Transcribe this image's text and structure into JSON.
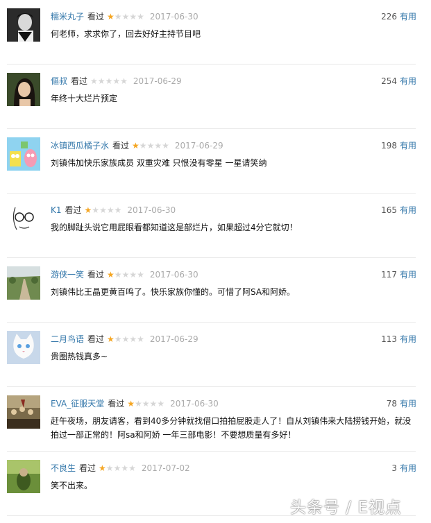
{
  "reviews": [
    {
      "user": "糯米丸子",
      "watched": "看过",
      "rating": 1,
      "date": "2017-06-30",
      "useful_count": "226",
      "useful_label": "有用",
      "comment": "何老师，求求你了，回去好好主持节目吧",
      "avatar": "portrait-man-bw"
    },
    {
      "user": "傴叔",
      "watched": "看过",
      "rating": 0,
      "date": "2017-06-29",
      "useful_count": "254",
      "useful_label": "有用",
      "comment": "年终十大烂片预定",
      "avatar": "portrait-woman"
    },
    {
      "user": "冰镇西瓜橘子水",
      "watched": "看过",
      "rating": 1,
      "date": "2017-06-29",
      "useful_count": "198",
      "useful_label": "有用",
      "comment": "刘镇伟加快乐家族成员 双重灾难 只恨没有零星 一星请笑纳",
      "avatar": "cartoon-sponge"
    },
    {
      "user": "K1",
      "watched": "看过",
      "rating": 1,
      "date": "2017-06-30",
      "useful_count": "165",
      "useful_label": "有用",
      "comment": "我的脚趾头说它用屁眼看都知道这是部烂片，如果超过4分它就切！",
      "avatar": "sketch-face-glasses"
    },
    {
      "user": "游侠一笑",
      "watched": "看过",
      "rating": 1,
      "date": "2017-06-30",
      "useful_count": "117",
      "useful_label": "有用",
      "comment": "刘镇伟比王晶更黄百鸣了。快乐家族你懂的。可惜了阿SA和阿娇。",
      "avatar": "landscape-path"
    },
    {
      "user": "二月鸟语",
      "watched": "看过",
      "rating": 1,
      "date": "2017-06-29",
      "useful_count": "113",
      "useful_label": "有用",
      "comment": "贵圈热钱真多~",
      "avatar": "white-cat"
    },
    {
      "user": "EVA_征服天堂",
      "watched": "看过",
      "rating": 1,
      "date": "2017-06-30",
      "useful_count": "78",
      "useful_label": "有用",
      "comment": "赶午夜场，朋友请客，看到40多分钟就找借口拍拍屁股走人了！自从刘镇伟来大陆捞钱开始，就没拍过一部正常的！阿sa和阿娇 一年三部电影！不要想质量有多好！",
      "avatar": "painting-crowd"
    },
    {
      "user": "不良生",
      "watched": "看过",
      "rating": 1,
      "date": "2017-07-02",
      "useful_count": "3",
      "useful_label": "有用",
      "comment": "笑不出来。",
      "avatar": "green-figure"
    }
  ],
  "stars_total": 5,
  "colors": {
    "link": "#3377aa",
    "star_on": "#f5a623",
    "star_off": "#d6d6d6",
    "date": "#aaaaaa"
  },
  "watermark": "头条号 / E视点"
}
